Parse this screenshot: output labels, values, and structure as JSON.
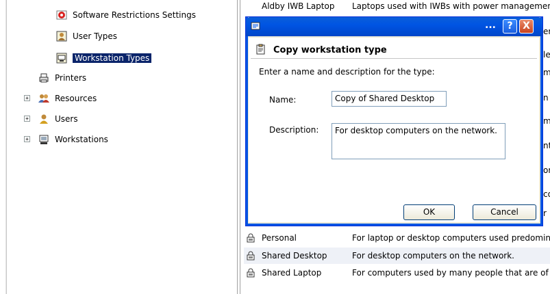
{
  "tree": {
    "items": [
      {
        "label": "Software Restrictions Settings",
        "icon": "shield-icon"
      },
      {
        "label": "User Types",
        "icon": "user-type-icon"
      },
      {
        "label": "Workstation Types",
        "icon": "workstation-icon",
        "selected": true
      },
      {
        "label": "Printers",
        "icon": "printer-icon"
      },
      {
        "label": "Resources",
        "icon": "people-icon",
        "expander": "+"
      },
      {
        "label": "Users",
        "icon": "user-icon",
        "expander": "+"
      },
      {
        "label": "Workstations",
        "icon": "computer-icon",
        "expander": "+"
      }
    ]
  },
  "list": {
    "rows": [
      {
        "name": "Aldby IWB Laptop",
        "description": "Laptops used with IWBs with power managemen"
      },
      {
        "name": "Personal",
        "description": "For laptop or desktop computers used predomin"
      },
      {
        "name": "Shared Desktop",
        "description": "For desktop computers on the network."
      },
      {
        "name": "Shared Laptop",
        "description": "For computers used by many people that are of"
      }
    ],
    "partial_letters": [
      "er",
      "le",
      "m",
      "n",
      "m",
      "nt",
      "or",
      "co",
      "r"
    ]
  },
  "dialog": {
    "dots": "...",
    "help": "?",
    "close": "X",
    "heading": "Copy workstation type",
    "instruction": "Enter a name and description for the type:",
    "name_label": "Name:",
    "name_value": "Copy of Shared Desktop",
    "description_label": "Description:",
    "description_value": "For desktop computers on the network.",
    "ok_label": "OK",
    "cancel_label": "Cancel"
  },
  "colors": {
    "selection": "#0a246a",
    "titlebar": "#0054e3",
    "dialog_face": "#ece9d8",
    "row_alt": "#eef1f7"
  }
}
